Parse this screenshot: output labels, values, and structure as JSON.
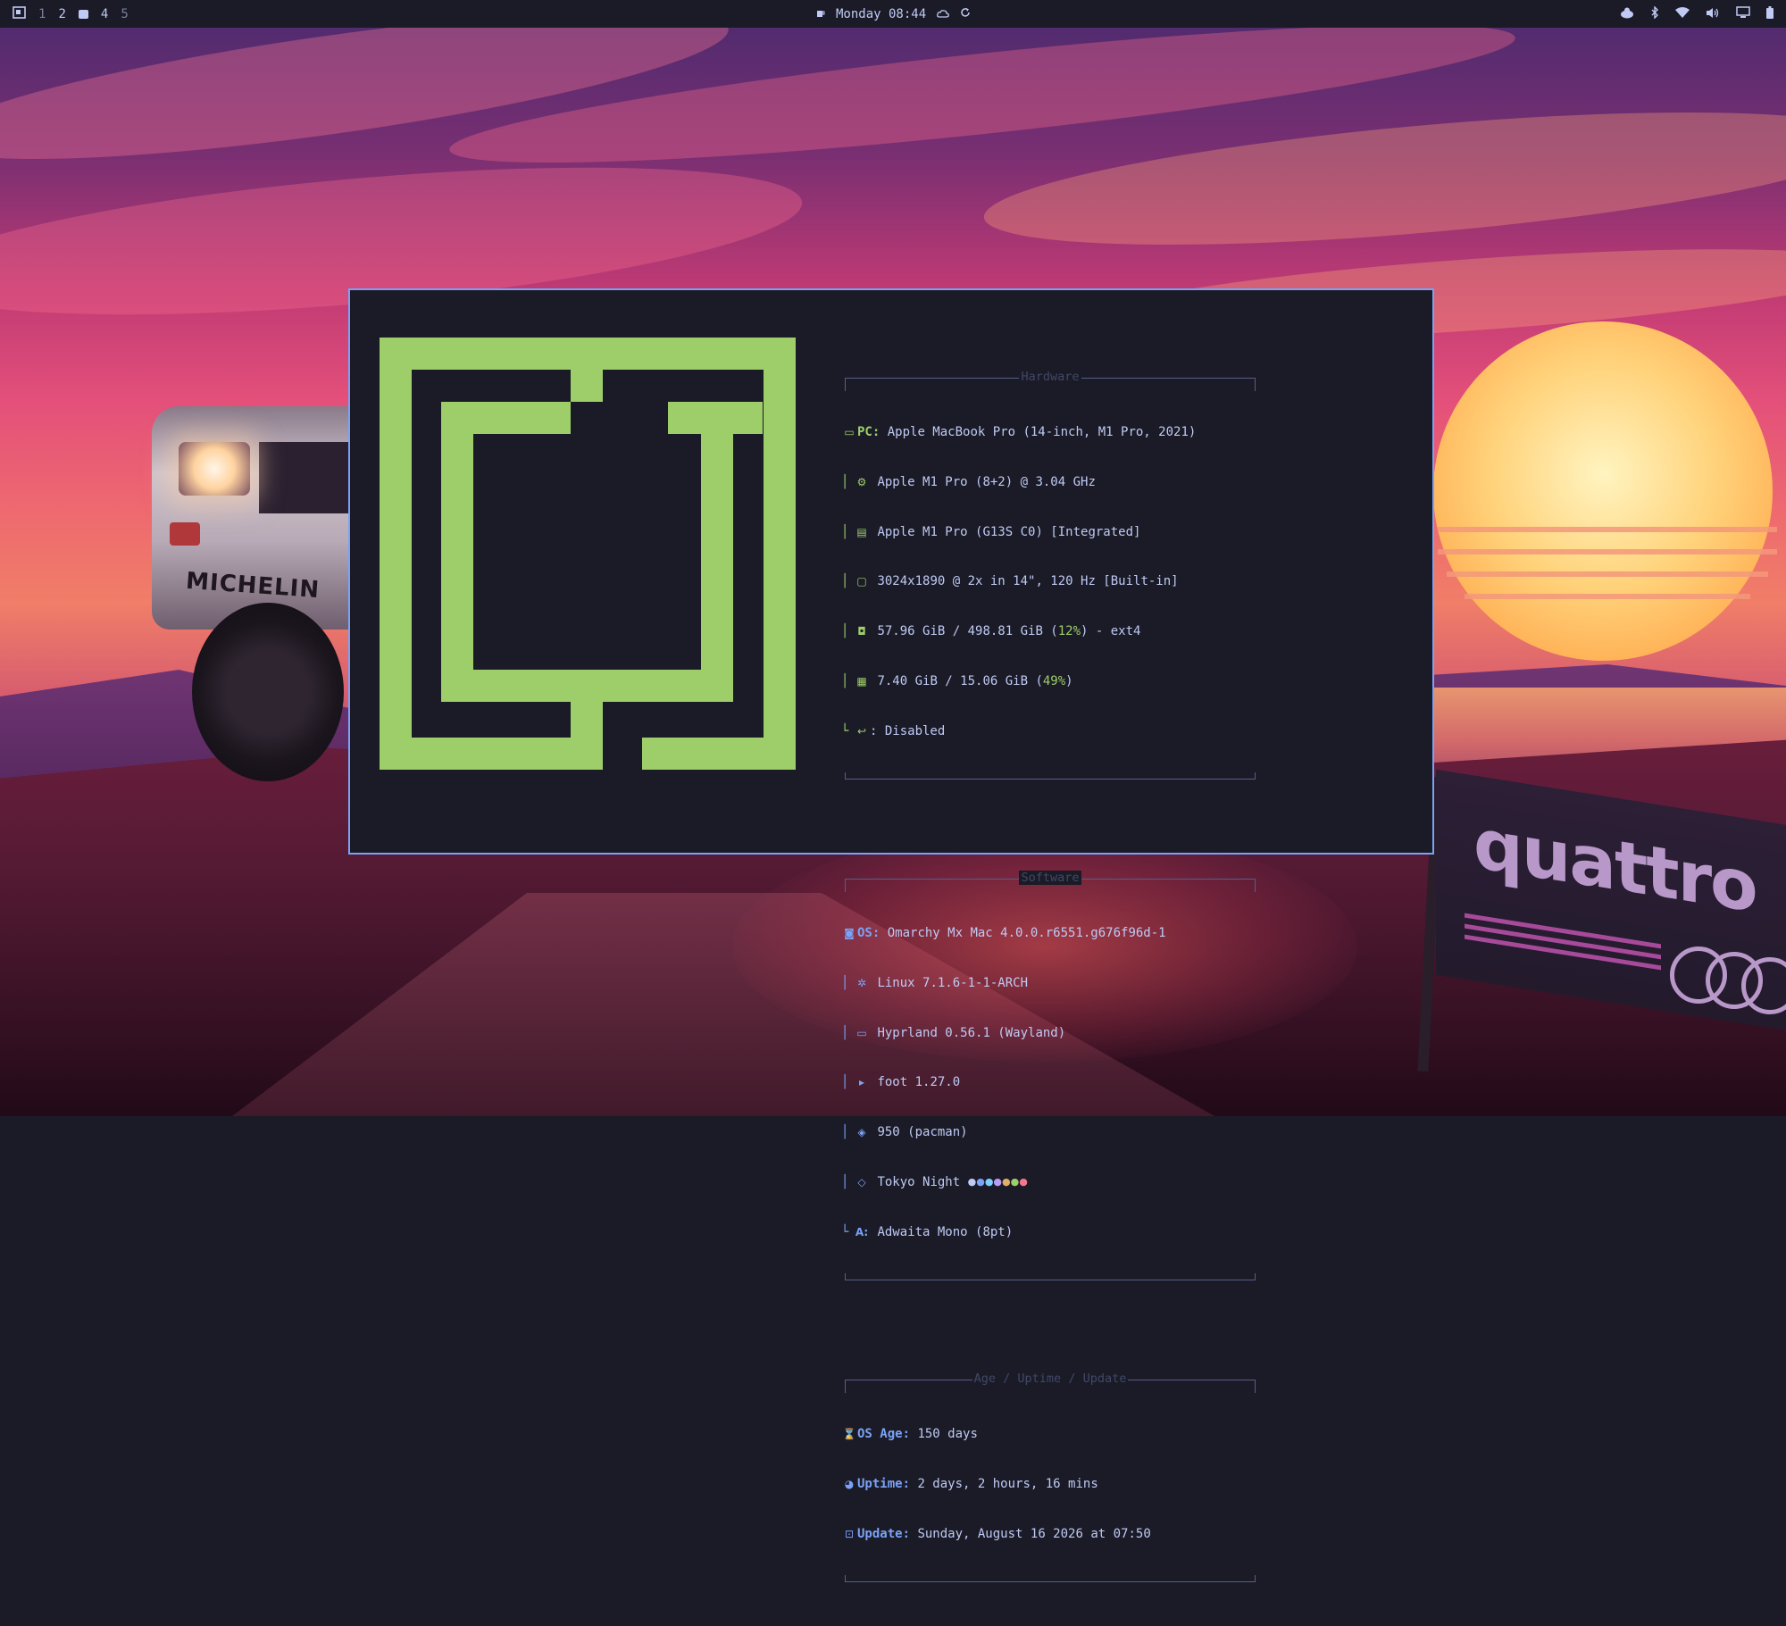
{
  "topbar": {
    "workspaces": [
      "1",
      "2",
      "3",
      "4",
      "5"
    ],
    "clock": "Monday 08:44",
    "left_icon": "omarchy-menu-icon",
    "center_icons": [
      "coffee-icon",
      "cloud-icon",
      "refresh-icon"
    ],
    "right_icons": [
      "cpu-icon",
      "bluetooth-icon",
      "wifi-icon",
      "volume-icon",
      "monitor-icon",
      "battery-icon"
    ]
  },
  "fastfetch": {
    "hardware": {
      "title": "Hardware",
      "pc_key": "PC:",
      "pc_value": "Apple MacBook Pro (14-inch, M1 Pro, 2021)",
      "cpu": "Apple M1 Pro (8+2) @ 3.04 GHz",
      "gpu": "Apple M1 Pro (G13S C0) [Integrated]",
      "display": "3024x1890 @ 2x in 14\", 120 Hz [Built-in]",
      "disk_pre": "57.96 GiB / 498.81 GiB (",
      "disk_pct": "12%",
      "disk_post": ") - ext4",
      "mem_pre": "7.40 GiB / 15.06 GiB (",
      "mem_pct": "49%",
      "mem_post": ")",
      "swap": ": Disabled"
    },
    "software": {
      "title": "Software",
      "os_key": "OS:",
      "os_value": "Omarchy Mx Mac 4.0.0.r6551.g676f96d-1",
      "kernel": "Linux 7.1.6-1-1-ARCH",
      "wm": "Hyprland 0.56.1 (Wayland)",
      "terminal": "foot 1.27.0",
      "packages": "950 (pacman)",
      "theme": "Tokyo Night",
      "theme_dots": [
        "#c0caf5",
        "#7aa2f7",
        "#7dcfff",
        "#bb9af7",
        "#e0af68",
        "#9ece6a",
        "#f7768e"
      ],
      "font_key": "A:",
      "font": "Adwaita Mono (8pt)"
    },
    "age": {
      "title": "Age / Uptime / Update",
      "os_age_key": "OS Age:",
      "os_age": "150 days",
      "uptime_key": "Uptime:",
      "uptime": "2 days, 2 hours, 16 mins",
      "update_key": "Update:",
      "update": "Sunday, August 16 2026 at 07:50"
    }
  },
  "wallpaper": {
    "car_text": "MICHELIN",
    "banner_text": "quattro"
  },
  "colors": {
    "accent_green": "#9ece6a",
    "accent_blue": "#7aa2f7",
    "bg": "#1a1b26",
    "fg": "#c0caf5"
  }
}
